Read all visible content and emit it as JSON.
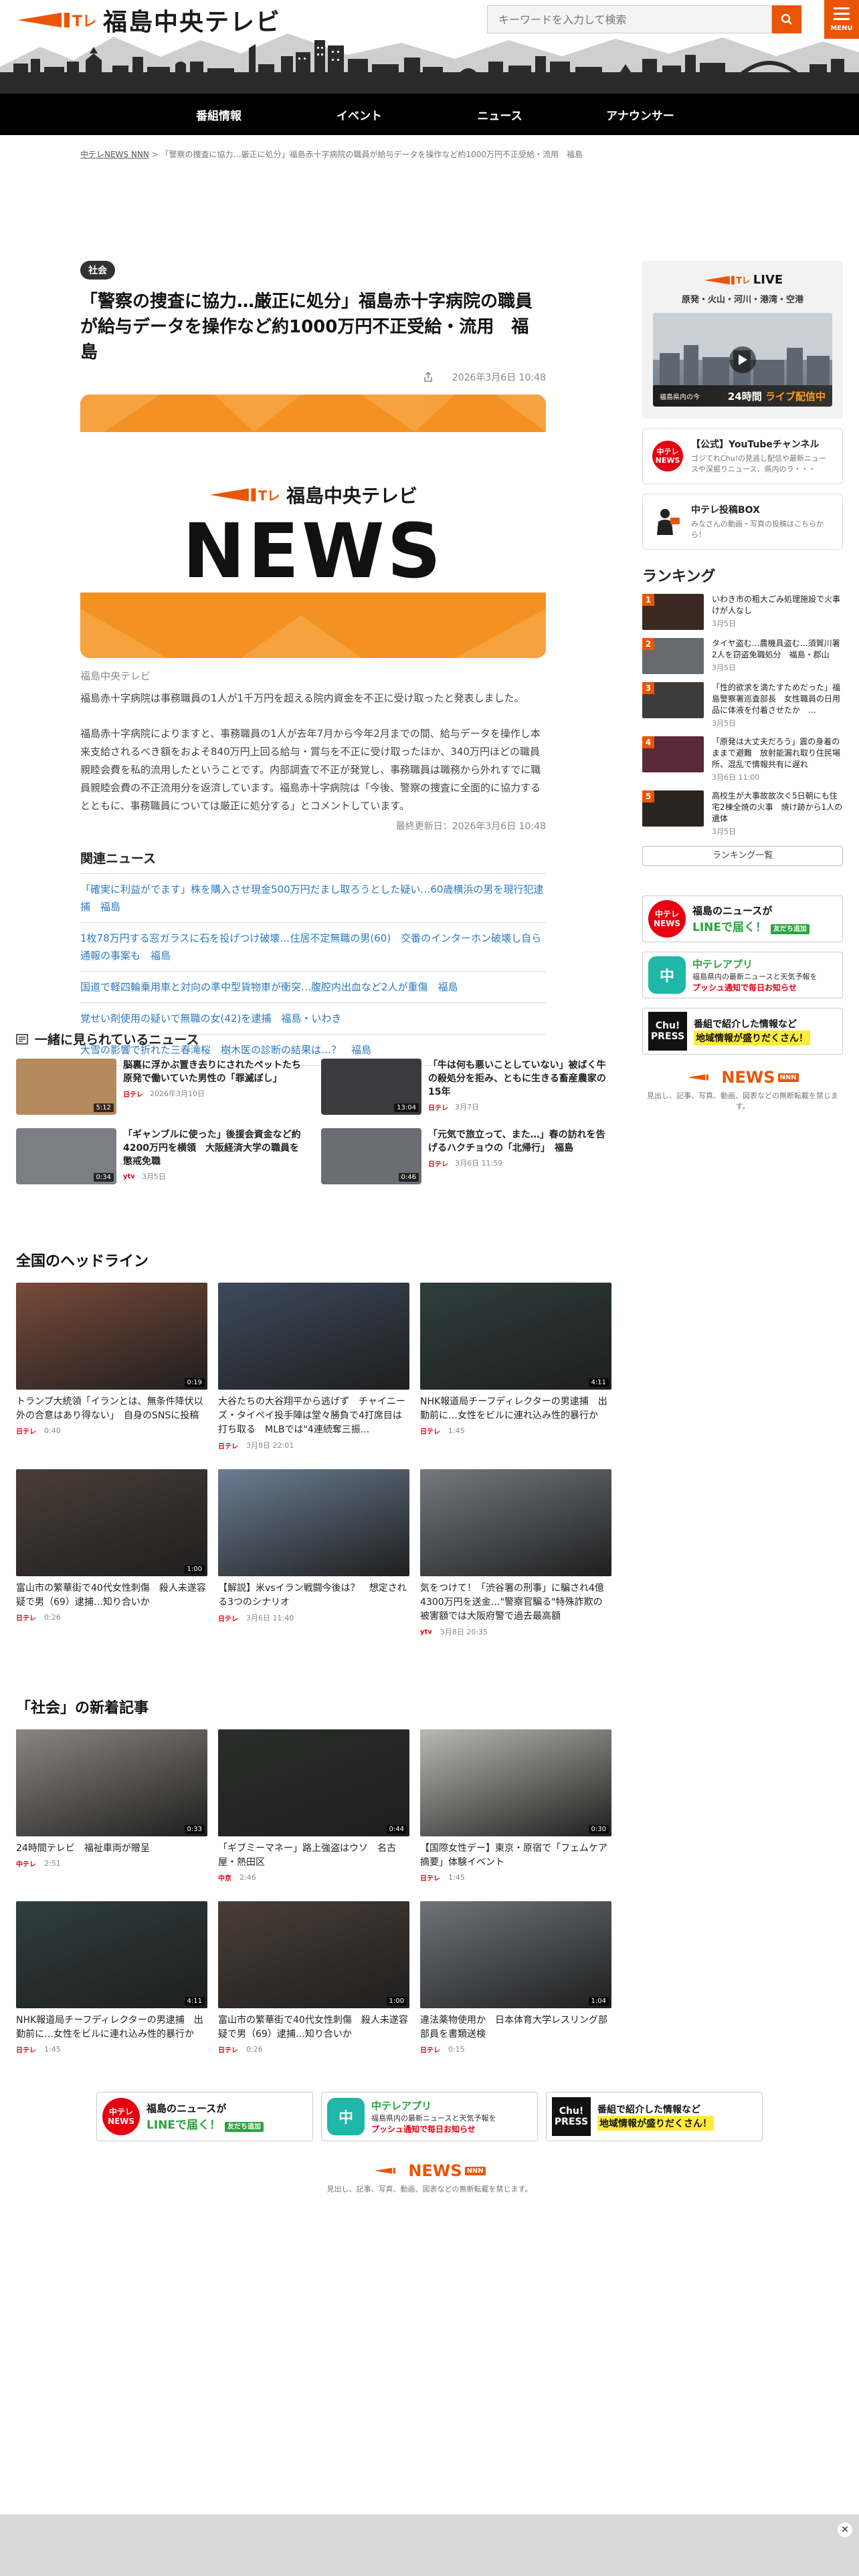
{
  "header": {
    "site_name": "福島中央テレビ",
    "search_placeholder": "キーワードを入力して検索",
    "menu_label": "MENU",
    "nav": [
      "番組情報",
      "イベント",
      "ニュース",
      "アナウンサー"
    ]
  },
  "breadcrumb": {
    "home": "中テレNEWS NNN",
    "sep": ">",
    "current": "「警察の捜査に協力…厳正に処分」福島赤十字病院の職員が給与データを操作など約1000万円不正受給・流用　福島"
  },
  "article": {
    "category": "社会",
    "title": "「警察の捜査に協力…厳正に処分」福島赤十字病院の職員が給与データを操作など約1000万円不正受給・流用　福島",
    "datetime": "2026年3月6日 10:48",
    "hero_logo": "福島中央テレビ",
    "hero_news": "NEWS",
    "source": "福島中央テレビ",
    "lead": "福島赤十字病院は事務職員の1人が1千万円を超える院内資金を不正に受け取ったと発表しました。",
    "body": "福島赤十字病院によりますと、事務職員の1人が去年7月から今年2月までの間、給与データを操作し本来支給されるべき額をおよそ840万円上回る給与・賞与を不正に受け取ったほか、340万円ほどの職員親睦会費を私的流用したということです。内部調査で不正が発覚し、事務職員は職務から外れすでに職員親睦会費の不正流用分を返済しています。福島赤十字病院は「今後、警察の捜査に全面的に協力するとともに、事務職員については厳正に処分する」とコメントしています。",
    "updated": "最終更新日：2026年3月6日 10:48"
  },
  "related": {
    "heading": "関連ニュース",
    "items": [
      "「確実に利益がでます」株を購入させ現金500万円だまし取ろうとした疑い…60歳横浜の男を現行犯逮捕　福島",
      "1枚78万円する窓ガラスに石を投げつけ破壊…住居不定無職の男(60)　交番のインターホン破壊し自ら通報の事案も　福島",
      "国道で軽四輪乗用車と対向の準中型貨物車が衝突…腹腔内出血など2人が重傷　福島",
      "覚せい剤使用の疑いで無職の女(42)を逮捕　福島・いわき",
      "大雪の影響で折れた三春滝桜　樹木医の診断の結果は…？　福島"
    ]
  },
  "sidebar": {
    "live_title": "LIVE",
    "live_sub": "原発・火山・河川・港湾・空港",
    "live_banner_small": "福島県内の今",
    "live_banner_24": "24時間",
    "live_banner_main": "ライブ配信中",
    "youtube_icon": "中テレ NEWS",
    "youtube_title": "【公式】YouTubeチャンネル",
    "youtube_desc": "ゴジてれChu!の見逃し配信や最新ニュースや深掘りニュース、県内のラ・・・",
    "post_title": "中テレ投稿BOX",
    "post_desc": "みなさんの動画・写真の投稿はこちらから！",
    "ranking_heading": "ランキング",
    "ranking": [
      {
        "title": "いわき市の粗大ごみ処理施設で火事　けが人なし",
        "date": "3月5日",
        "color": "#3a2a22"
      },
      {
        "title": "タイヤ盗む…農機具盗む…須賀川署2人を窃盗免職処分　福島・郡山",
        "date": "3月5日",
        "color": "#646a70"
      },
      {
        "title": "「性的欲求を満たすためだった」福島警察署巡査部長　女性職員の日用品に体液を付着させたか　…",
        "date": "3月5日",
        "color": "#3c3c3c"
      },
      {
        "title": "「原発は大丈夫だろう」震の身着のままで避難　放射能漏れ取り住民場所、混乱で情報共有に遅れ",
        "date": "3月6日 11:00",
        "color": "#5a2a3a"
      },
      {
        "title": "高校生が大事故故次ぐ5日朝にも住宅2棟全焼の火事　焼け跡から1人の遺体",
        "date": "3月5日",
        "color": "#2a2420"
      }
    ],
    "ranking_more": "ランキング一覧"
  },
  "promos": {
    "line_badge": "中テレ NEWS",
    "line_t1": "福島のニュースが",
    "line_t2": "LINEで届く！",
    "line_cta": "友だち追加",
    "app_icon": "中",
    "app_t1": "中テレアプリ",
    "app_t2": "福島県内の最新ニュースと天気予報を",
    "app_t3": "プッシュ通知で毎日お知らせ",
    "chu_badge_1": "Chu!",
    "chu_badge_2": "PRESS",
    "chu_t1": "番組で紹介した情報など",
    "chu_t2": "地域情報が盛りだくさん！"
  },
  "nnn": {
    "logo_sub": "福島中央テレビ",
    "logo": "NEWS",
    "caption": "見出し、記事、写真、動画、図表などの無断転載を禁じます。"
  },
  "together": {
    "heading": "一緒に見られているニュース",
    "items": [
      {
        "title": "脳裏に浮かぶ置き去りにされたペットたち　原発で働いていた男性の「罪滅ぼし」",
        "date": "2026年3月10日",
        "dur": "5:12",
        "color": "#b58a5e",
        "logo": "日テレ"
      },
      {
        "title": "「牛は何も悪いことしていない」被ばく牛の殺処分を拒み、ともに生きる畜産農家の15年",
        "date": "3月7日",
        "dur": "13:04",
        "color": "#3b3a3e",
        "logo": "日テレ"
      },
      {
        "title": "「ギャンブルに使った」後援会資金など約4200万円を横領　大阪経済大学の職員を懲戒免職",
        "date": "3月5日",
        "dur": "0:34",
        "color": "#7b7f84",
        "logo": "ytv"
      },
      {
        "title": "「元気で旅立って、また…」春の訪れを告げるハクチョウの「北帰行」　福島",
        "date": "3月6日 11:59",
        "dur": "0:46",
        "color": "#6a6e72",
        "logo": "日テレ"
      }
    ]
  },
  "headlines": {
    "heading": "全国のヘッドライン",
    "items": [
      {
        "title": "トランプ大統領「イランとは、無条件降伏以外の合意はあり得ない」　自身のSNSに投稿",
        "time": "0:40",
        "dur": "0:19",
        "color": "#7a4a3a",
        "logo": "日テレ"
      },
      {
        "title": "大谷たちの大谷翔平から逃げず　チャイニーズ・タイペイ投手陣は堂々勝負で4打席目は打ち取る　MLBでは\"4連続奪三振...",
        "time": "3月8日 22:01",
        "dur": "",
        "color": "#3d4a5c",
        "logo": "日テレ"
      },
      {
        "title": "NHK報道局チーフディレクターの男逮捕　出勤前に…女性をビルに連れ込み性的暴行か",
        "time": "1:45",
        "dur": "4:11",
        "color": "#2f3f3c",
        "logo": "日テレ"
      },
      {
        "title": "富山市の繁華街で40代女性刺傷　殺人未遂容疑で男（69）逮捕…知り合いか",
        "time": "0:26",
        "dur": "1:00",
        "color": "#4a3e36",
        "logo": "日テレ"
      },
      {
        "title": "【解説】米vsイラン戦闘今後は？　想定される3つのシナリオ",
        "time": "3月6日 11:40",
        "dur": "",
        "color": "#6b7d93",
        "logo": "日テレ"
      },
      {
        "title": "気をつけて！「渋谷署の刑事」に騙され4億4300万円を送金…\"警察官騙る\"特殊詐欺の被害額では大阪府警で過去最高額",
        "time": "3月8日 20:35",
        "dur": "",
        "color": "#74797e",
        "logo": "ytv"
      }
    ]
  },
  "shakai": {
    "heading": "「社会」の新着記事",
    "items": [
      {
        "title": "24時間テレビ　福祉車両が贈呈",
        "time": "2:51",
        "dur": "0:33",
        "color": "#8a8782",
        "logo": "中テレ"
      },
      {
        "title": "「ギブミーマネー」路上強盗はウソ　名古屋・熱田区",
        "time": "2:46",
        "dur": "0:44",
        "color": "#2a2d2a",
        "logo": "中京"
      },
      {
        "title": "【国際女性デー】東京・原宿で「フェムケア摘要」体験イベント",
        "time": "1:45",
        "dur": "0:30",
        "color": "#b8b9b4",
        "logo": "日テレ"
      },
      {
        "title": "NHK報道局チーフディレクターの男逮捕　出勤前に…女性をビルに連れ込み性的暴行か",
        "time": "1:45",
        "dur": "4:11",
        "color": "#2f3f3c",
        "logo": "日テレ"
      },
      {
        "title": "富山市の繁華街で40代女性刺傷　殺人未遂容疑で男（69）逮捕…知り合いか",
        "time": "0:26",
        "dur": "1:00",
        "color": "#4a3e36",
        "logo": "日テレ"
      },
      {
        "title": "違法薬物使用か　日本体育大学レスリング部部員を書類送検",
        "time": "0:15",
        "dur": "1:04",
        "color": "#6f7378",
        "logo": "日テレ"
      }
    ]
  },
  "colors": {
    "accent": "#ea5504",
    "nav_bg": "#000000",
    "link": "#2a7bc1"
  }
}
